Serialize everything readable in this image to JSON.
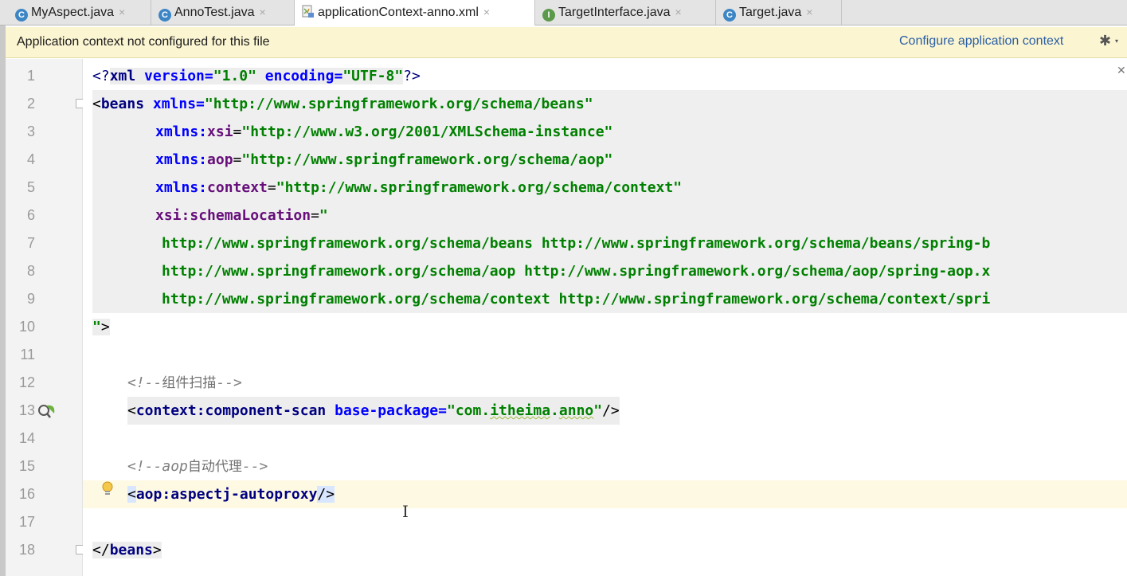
{
  "tabs": [
    {
      "label": "MyAspect.java",
      "icon": "class-icon",
      "close": "×",
      "active": false
    },
    {
      "label": "AnnoTest.java",
      "icon": "class-run-icon",
      "close": "×",
      "active": false
    },
    {
      "label": "applicationContext-anno.xml",
      "icon": "xml-file-icon",
      "close": "×",
      "active": true
    },
    {
      "label": "TargetInterface.java",
      "icon": "interface-icon",
      "close": "×",
      "active": false
    },
    {
      "label": "Target.java",
      "icon": "class-icon",
      "close": "×",
      "active": false
    }
  ],
  "banner": {
    "message": "Application context not configured for this file",
    "action": "Configure application context",
    "gear": "✱",
    "caret": "▾"
  },
  "gutter": {
    "line_numbers": [
      "1",
      "2",
      "3",
      "4",
      "5",
      "6",
      "7",
      "8",
      "9",
      "10",
      "11",
      "12",
      "13",
      "14",
      "15",
      "16",
      "17",
      "18"
    ]
  },
  "code": {
    "l1": {
      "open": "<?",
      "tag": "xml",
      "a1": " version=",
      "v1": "\"1.0\"",
      "a2": " encoding=",
      "v2": "\"UTF-8\"",
      "close": "?>"
    },
    "l2": {
      "open": "<",
      "tag": "beans",
      "attr": " xmlns=",
      "val": "\"http://www.springframework.org/schema/beans\""
    },
    "l3": {
      "ns": "xmlns:",
      "name": "xsi",
      "eq": "=",
      "val": "\"http://www.w3.org/2001/XMLSchema-instance\""
    },
    "l4": {
      "ns": "xmlns:",
      "name": "aop",
      "eq": "=",
      "val": "\"http://www.springframework.org/schema/aop\""
    },
    "l5": {
      "ns": "xmlns:",
      "name": "context",
      "eq": "=",
      "val": "\"http://www.springframework.org/schema/context\""
    },
    "l6": {
      "ns": "xsi:",
      "name": "schemaLocation",
      "eq": "=",
      "val": "\""
    },
    "l7": {
      "val": "http://www.springframework.org/schema/beans http://www.springframework.org/schema/beans/spring-b"
    },
    "l8": {
      "val": "http://www.springframework.org/schema/aop http://www.springframework.org/schema/aop/spring-aop.x"
    },
    "l9": {
      "val": "http://www.springframework.org/schema/context http://www.springframework.org/schema/context/spri"
    },
    "l10": {
      "val": "\"",
      "close": ">"
    },
    "l12": {
      "open": "<!--",
      "text": "组件扫描",
      "close": "-->"
    },
    "l13": {
      "open": "<",
      "tag": "context:component-scan",
      "attr": " base-package=",
      "val_q1": "\"",
      "val_a": "com.",
      "val_b": "itheima",
      "val_c": ".",
      "val_d": "anno",
      "val_q2": "\"",
      "close": "/>"
    },
    "l15": {
      "open": "<!--",
      "latin": "aop",
      "text": "自动代理",
      "close": "-->"
    },
    "l16": {
      "open": "<",
      "tag": "aop:aspectj-autoproxy",
      "close": "/>"
    },
    "l18": {
      "open": "</",
      "tag": "beans",
      "close": ">"
    }
  },
  "editor": {
    "text_cursor": "I",
    "hide_panel": "✕"
  },
  "colors": {
    "tag": "#000080",
    "attribute": "#0000ff",
    "namespace": "#660e7a",
    "value": "#008000",
    "comment": "#808080",
    "banner_bg": "#fbf5d2",
    "current_line": "#fdf9e3"
  }
}
